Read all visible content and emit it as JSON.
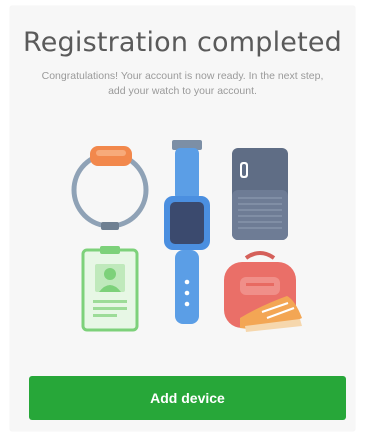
{
  "header": {
    "title": "Registration completed",
    "subtitle": "Congratulations! Your account is now ready. In the next step, add your watch to your account."
  },
  "actions": {
    "add_device_label": "Add device"
  },
  "illustration": {
    "items": [
      "fitness-band",
      "smartwatch",
      "id-card",
      "tracker-device",
      "backpack-with-shoes"
    ]
  },
  "colors": {
    "primary": "#27a739",
    "background": "#f7f7f7",
    "title": "#5a5a5a",
    "subtitle": "#9a9a9a"
  }
}
